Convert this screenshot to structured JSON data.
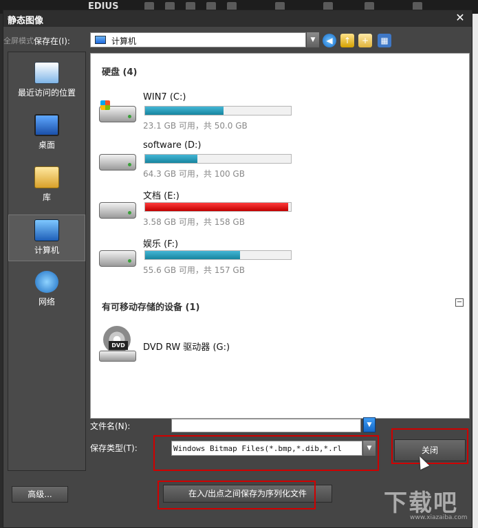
{
  "background_app": {
    "brand": "EDIUS"
  },
  "dialog": {
    "title": "静态图像",
    "close_glyph": "✕",
    "ghost_hint": "全屏模式",
    "save_in_label": "保存在(I):",
    "save_in_value": "计算机"
  },
  "places": [
    {
      "label": "最近访问的位置",
      "icon": "recent-places-icon"
    },
    {
      "label": "桌面",
      "icon": "desktop-icon"
    },
    {
      "label": "库",
      "icon": "libraries-icon"
    },
    {
      "label": "计算机",
      "icon": "computer-icon",
      "selected": true
    },
    {
      "label": "网络",
      "icon": "network-icon"
    }
  ],
  "file_list": {
    "hard_disks_header": "硬盘 (4)",
    "drives": [
      {
        "name": "WIN7 (C:)",
        "space": "23.1 GB 可用，共 50.0 GB",
        "used_fraction": 0.54,
        "color": "#17859f"
      },
      {
        "name": "software (D:)",
        "space": "64.3 GB 可用，共 100 GB",
        "used_fraction": 0.36,
        "color": "#17859f"
      },
      {
        "name": "文档 (E:)",
        "space": "3.58 GB 可用，共 158 GB",
        "used_fraction": 0.98,
        "color": "#c00000"
      },
      {
        "name": "娱乐 (F:)",
        "space": "55.6 GB 可用，共 157 GB",
        "used_fraction": 0.65,
        "color": "#17859f"
      }
    ],
    "removable_header": "有可移动存储的设备 (1)",
    "collapse_glyph": "⊟",
    "dvd": {
      "name": "DVD RW 驱动器 (G:)",
      "badge": "DVD"
    }
  },
  "bottom": {
    "filename_label": "文件名(N):",
    "filename_value": "",
    "filetype_label": "保存类型(T):",
    "filetype_value": "Windows Bitmap Files(*.bmp,*.dib,*.rl",
    "close_button": "关闭",
    "advanced_button": "高级...",
    "serialize_button": "在入/出点之间保存为序列化文件"
  },
  "watermark": {
    "text": "下载吧",
    "sub": "www.xiazaiba.com"
  }
}
